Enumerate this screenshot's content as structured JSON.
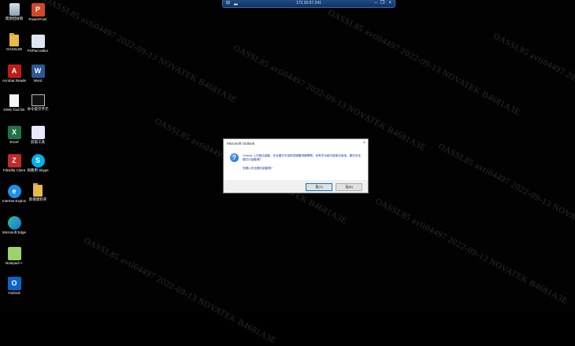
{
  "remote_bar": {
    "title": "172.20.57.241",
    "pin_glyph": "⊟",
    "restore_glyph": "❐",
    "minimize_glyph": "–",
    "close_glyph": "×"
  },
  "watermark": {
    "lines": [
      "OASSL85  avti04497  2022-09-13  NOVATEK  B4681A3E",
      "OASSL85  avti04497  2022-09-13  NOVATEK  B4681A3E",
      "OASSL85  avti04497  2022-09-13  NOVATEK  B4681A3E",
      "OASSL85  avti04497  2022-09-13  NOVATEK  B4681A3E"
    ]
  },
  "desktop_icons": [
    {
      "label": "資源回收筒",
      "icon": "recycle-bin-icon"
    },
    {
      "label": "PowerPoint",
      "icon": "powerpoint-icon"
    },
    {
      "label": "OASSL85",
      "icon": "folder-icon"
    },
    {
      "label": "PSPad editor",
      "icon": "pspad-icon"
    },
    {
      "label": "Acrobat Reader DC",
      "icon": "acrobat-icon"
    },
    {
      "label": "Word",
      "icon": "word-icon"
    },
    {
      "label": "DWS Tool.lnk",
      "icon": "document-icon"
    },
    {
      "label": "命令提示字元",
      "icon": "command-prompt-icon"
    },
    {
      "label": "Excel",
      "icon": "excel-icon"
    },
    {
      "label": "剪取工具",
      "icon": "snipping-tool-icon"
    },
    {
      "label": "FileZilla Client",
      "icon": "filezilla-icon"
    },
    {
      "label": "商務用 Skype",
      "icon": "skype-icon"
    },
    {
      "label": "Internet Explorer",
      "icon": "internet-explorer-icon"
    },
    {
      "label": "新增資料夾",
      "icon": "folder-icon"
    },
    {
      "label": "Microsoft Edge",
      "icon": "edge-icon"
    },
    {
      "label": "Notepad++",
      "icon": "notepad-plus-plus-icon"
    },
    {
      "label": "Outlook",
      "icon": "outlook-icon"
    }
  ],
  "dialog": {
    "title": "Microsoft Outlook",
    "close_glyph": "×",
    "message": "Outlook 上次無法啟動。安全模式可協助您疑難排解問題，但有些功能可能無法使用。要在安全模式中啟動嗎？",
    "question": "您要以安全模式啟動嗎？",
    "yes_label": "是(Y)",
    "no_label": "否(N)"
  },
  "colors": {
    "desktop_bg": "#020202",
    "accent": "#0078d7",
    "remote_bar": "#1f4c86"
  }
}
